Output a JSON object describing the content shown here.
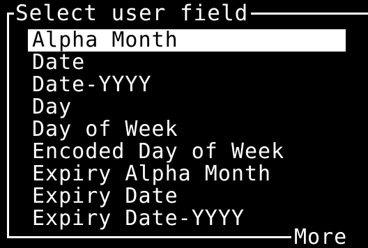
{
  "dialog": {
    "title": "Select user field",
    "more_label": "More"
  },
  "list": {
    "selected_index": 0,
    "items": [
      {
        "label": "Alpha Month"
      },
      {
        "label": "Date"
      },
      {
        "label": "Date-YYYY"
      },
      {
        "label": "Day"
      },
      {
        "label": "Day of Week"
      },
      {
        "label": "Encoded Day of Week"
      },
      {
        "label": "Expiry Alpha Month"
      },
      {
        "label": "Expiry Date"
      },
      {
        "label": "Expiry Date-YYYY"
      }
    ]
  },
  "colors": {
    "background": "#000000",
    "foreground": "#ffffff"
  }
}
